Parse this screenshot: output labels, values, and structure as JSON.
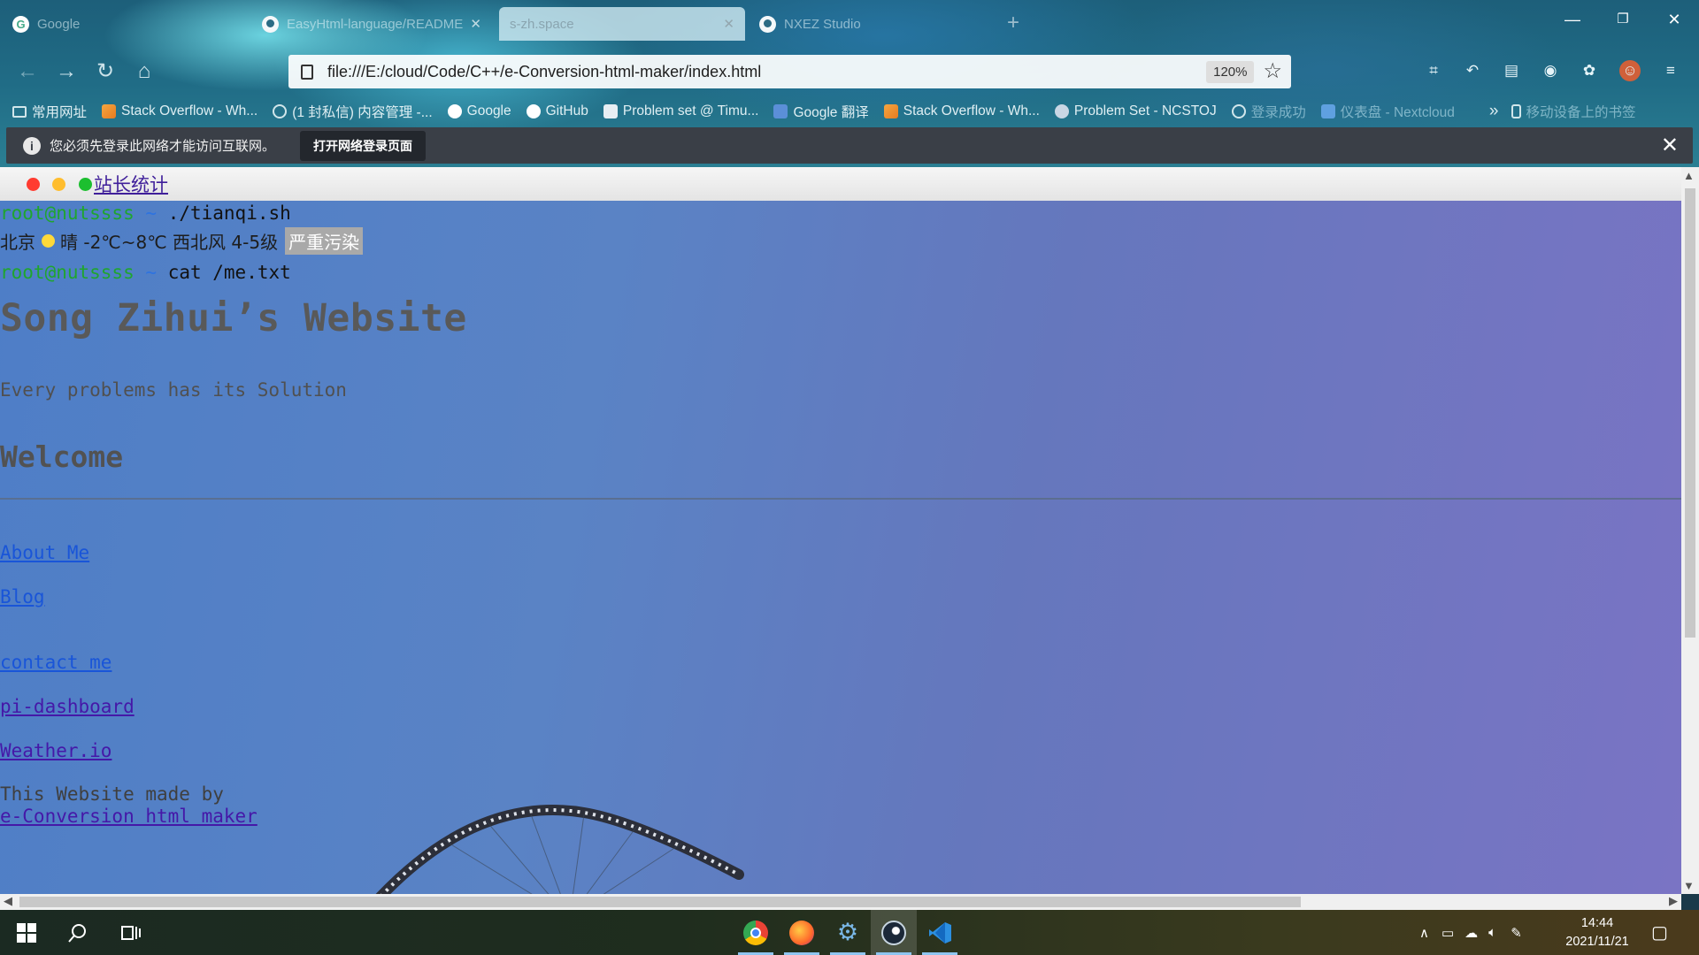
{
  "browser": {
    "tabs": [
      {
        "title": "Google",
        "icon": "google-icon"
      },
      {
        "title": "EasyHtml-language/README",
        "icon": "github-icon"
      },
      {
        "title": "s-zh.space",
        "icon": "none",
        "active": true
      },
      {
        "title": "NXEZ Studio",
        "icon": "github-icon"
      }
    ],
    "new_tab": "+",
    "window_controls": {
      "minimize": "—",
      "maximize": "❐",
      "close": "✕"
    },
    "url": "file:///E:/cloud/Code/C++/e-Conversion-html-maker/index.html",
    "zoom": "120%",
    "bookmarks": [
      {
        "label": "常用网址",
        "icon": "folder-icon"
      },
      {
        "label": "Stack Overflow - Wh...",
        "icon": "stackoverflow-icon"
      },
      {
        "label": "(1 封私信) 内容管理 -...",
        "icon": "globe-icon"
      },
      {
        "label": "Google",
        "icon": "google-icon"
      },
      {
        "label": "GitHub",
        "icon": "github-icon"
      },
      {
        "label": "Problem set @ Timu...",
        "icon": "problemset-icon"
      },
      {
        "label": "Google 翻译",
        "icon": "google-translate-icon"
      },
      {
        "label": "Stack Overflow - Wh...",
        "icon": "stackoverflow-icon"
      },
      {
        "label": "Problem Set - NCSTOJ",
        "icon": "ncstoj-icon"
      },
      {
        "label": "登录成功",
        "icon": "globe-icon"
      },
      {
        "label": "仪表盘 - Nextcloud",
        "icon": "nextcloud-icon"
      }
    ],
    "bookmarks_more": "»",
    "mobile_bookmarks": "移动设备上的书签",
    "infobar": {
      "message": "您必须先登录此网络才能访问互联网。",
      "button": "打开网络登录页面",
      "close": "✕"
    }
  },
  "page": {
    "stats_link": "站长统计",
    "prompt_user": "root@nutssss",
    "prompt_tilde": "~",
    "cmd1": "./tianqi.sh",
    "weather": {
      "city": "北京",
      "condition": "晴 -2℃~8℃ 西北风 4-5级",
      "pollution": "严重污染"
    },
    "cmd2": "cat /me.txt",
    "title": "Song Zihui’s Website",
    "subtitle": "Every problems has its Solution",
    "welcome": "Welcome",
    "links": {
      "about": "About Me",
      "blog": "Blog",
      "contact": "contact me",
      "pi": "pi-dashboard",
      "weather": "Weather.io"
    },
    "made_by": "This Website made by",
    "maker_link": "e-Conversion html maker"
  },
  "taskbar": {
    "time": "14:44",
    "date": "2021/11/21",
    "apps": [
      "chrome-icon",
      "firefox-icon",
      "settings-app-icon",
      "steam-icon",
      "vscode-icon"
    ]
  },
  "colors": {
    "page_bg_start": "#4e7ec7",
    "page_bg_end": "#7a74c4",
    "prompt_green": "#1fa52e",
    "link_blue": "#1955d8",
    "link_visited": "#4518a8"
  }
}
